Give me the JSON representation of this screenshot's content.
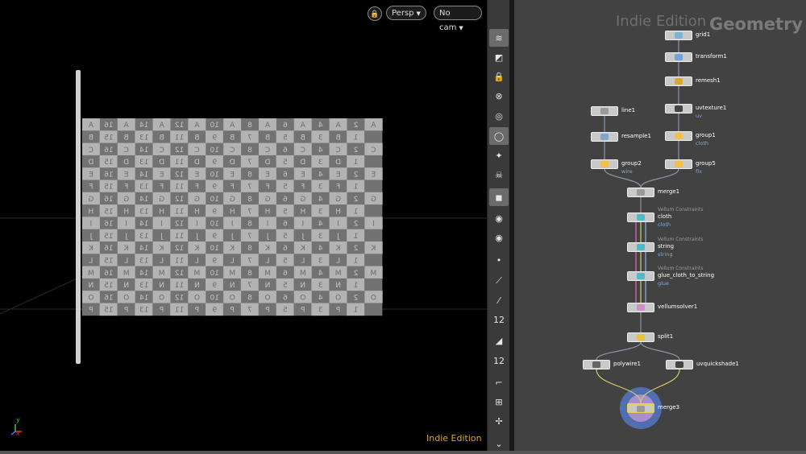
{
  "viewport": {
    "lock_icon": "lock-icon",
    "persp_label": "Persp",
    "camera_label": "No cam",
    "indie_label": "Indie Edition",
    "axis": {
      "x": "x",
      "y": "y"
    },
    "cloth_rows": [
      [
        "A",
        "16",
        "A",
        "14",
        "A",
        "12",
        "A",
        "10",
        "A",
        "8",
        "A",
        "6",
        "A",
        "4",
        "A",
        "2",
        "A"
      ],
      [
        "B",
        "15",
        "B",
        "13",
        "B",
        "11",
        "B",
        "9",
        "B",
        "7",
        "B",
        "5",
        "B",
        "3",
        "B",
        "1"
      ],
      [
        "C",
        "16",
        "C",
        "14",
        "C",
        "12",
        "C",
        "10",
        "C",
        "8",
        "C",
        "6",
        "C",
        "4",
        "C",
        "2",
        "C"
      ],
      [
        "D",
        "15",
        "D",
        "13",
        "D",
        "11",
        "D",
        "9",
        "D",
        "7",
        "D",
        "5",
        "D",
        "3",
        "D",
        "1"
      ],
      [
        "E",
        "16",
        "E",
        "14",
        "E",
        "12",
        "E",
        "10",
        "E",
        "8",
        "E",
        "6",
        "E",
        "4",
        "E",
        "2",
        "E"
      ],
      [
        "F",
        "15",
        "F",
        "13",
        "F",
        "11",
        "F",
        "9",
        "F",
        "7",
        "F",
        "5",
        "F",
        "3",
        "F",
        "1"
      ],
      [
        "G",
        "16",
        "G",
        "14",
        "G",
        "12",
        "G",
        "10",
        "G",
        "8",
        "G",
        "6",
        "G",
        "4",
        "G",
        "2",
        "G"
      ],
      [
        "H",
        "15",
        "H",
        "13",
        "H",
        "11",
        "H",
        "9",
        "H",
        "7",
        "H",
        "5",
        "H",
        "3",
        "H",
        "1"
      ],
      [
        "I",
        "16",
        "I",
        "14",
        "I",
        "12",
        "I",
        "10",
        "I",
        "8",
        "I",
        "6",
        "I",
        "4",
        "I",
        "2",
        "I"
      ],
      [
        "J",
        "15",
        "J",
        "13",
        "J",
        "11",
        "J",
        "9",
        "J",
        "7",
        "J",
        "5",
        "J",
        "3",
        "J",
        "1"
      ],
      [
        "K",
        "16",
        "K",
        "14",
        "K",
        "12",
        "K",
        "10",
        "K",
        "8",
        "K",
        "6",
        "K",
        "4",
        "K",
        "2",
        "K"
      ],
      [
        "L",
        "15",
        "L",
        "13",
        "L",
        "11",
        "L",
        "9",
        "L",
        "7",
        "L",
        "5",
        "L",
        "3",
        "L",
        "1"
      ],
      [
        "M",
        "16",
        "M",
        "14",
        "M",
        "12",
        "M",
        "10",
        "M",
        "8",
        "M",
        "6",
        "M",
        "4",
        "M",
        "2",
        "M"
      ],
      [
        "N",
        "15",
        "N",
        "13",
        "N",
        "11",
        "N",
        "9",
        "N",
        "7",
        "N",
        "5",
        "N",
        "3",
        "N",
        "1"
      ],
      [
        "O",
        "16",
        "O",
        "14",
        "O",
        "12",
        "O",
        "10",
        "O",
        "8",
        "O",
        "6",
        "O",
        "4",
        "O",
        "2",
        "O"
      ],
      [
        "P",
        "15",
        "P",
        "13",
        "P",
        "11",
        "P",
        "9",
        "P",
        "7",
        "P",
        "5",
        "P",
        "3",
        "P",
        "1"
      ]
    ]
  },
  "shelf": {
    "tools": [
      {
        "name": "display-options-icon",
        "glyph": "≋"
      },
      {
        "name": "view-icon",
        "glyph": "◩"
      },
      {
        "name": "lock-camera-icon",
        "glyph": "🔒"
      },
      {
        "name": "close-icon",
        "glyph": "⊗"
      },
      {
        "name": "shading-icon",
        "glyph": "◎"
      },
      {
        "name": "light-icon",
        "glyph": "◯"
      },
      {
        "name": "headlight-icon",
        "glyph": "✦"
      },
      {
        "name": "skull-icon",
        "glyph": "☠"
      },
      {
        "name": "camera-icon",
        "glyph": "◼"
      },
      {
        "name": "visibility-eye-icon",
        "glyph": "◉"
      },
      {
        "name": "ghost-eye-icon",
        "glyph": "◉"
      },
      {
        "name": "point-icon",
        "glyph": "•"
      },
      {
        "name": "normal-icon",
        "glyph": "⟋"
      },
      {
        "name": "point-normal-icon",
        "glyph": "⁄"
      },
      {
        "name": "point-number-icon",
        "glyph": "12"
      },
      {
        "name": "primitive-icon",
        "glyph": "◢"
      },
      {
        "name": "primitive-number-icon",
        "glyph": "12"
      },
      {
        "name": "edge-icon",
        "glyph": "⌐"
      },
      {
        "name": "grid-select-icon",
        "glyph": "⊞"
      },
      {
        "name": "snap-icon",
        "glyph": "✢"
      },
      {
        "name": "scroll-down-icon",
        "glyph": "⌄"
      }
    ]
  },
  "network": {
    "indie_label": "Indie Edition",
    "context_label": "Geometry",
    "nodes": [
      {
        "id": "grid1",
        "label": "grid1",
        "sub": "",
        "badge": "",
        "color": "#7fb3d6"
      },
      {
        "id": "transform1",
        "label": "transform1",
        "sub": "",
        "badge": "",
        "color": "#6fa6d9"
      },
      {
        "id": "remesh1",
        "label": "remesh1",
        "sub": "",
        "badge": "",
        "color": "#d9a63a"
      },
      {
        "id": "uvtexture1",
        "label": "uvtexture1",
        "sub": "uv",
        "badge": "",
        "color": "#444444"
      },
      {
        "id": "line1",
        "label": "line1",
        "sub": "",
        "badge": "",
        "color": "#9a9a9a"
      },
      {
        "id": "group1",
        "label": "group1",
        "sub": "cloth",
        "badge": "",
        "color": "#f2c04a"
      },
      {
        "id": "resample1",
        "label": "resample1",
        "sub": "",
        "badge": "",
        "color": "#7fa6cf"
      },
      {
        "id": "group2",
        "label": "group2",
        "sub": "wire",
        "badge": "",
        "color": "#f2c04a"
      },
      {
        "id": "group5",
        "label": "group5",
        "sub": "fix",
        "badge": "",
        "color": "#f2c04a"
      },
      {
        "id": "merge1",
        "label": "merge1",
        "sub": "",
        "badge": "",
        "color": "#9a9a9a"
      },
      {
        "id": "cloth",
        "label": "cloth",
        "sub": "cloth",
        "badge": "Vellum Constraints",
        "color": "#4fb9c6"
      },
      {
        "id": "string",
        "label": "string",
        "sub": "string",
        "badge": "Vellum Constraints",
        "color": "#4fb9c6"
      },
      {
        "id": "glue",
        "label": "glue_cloth_to_string",
        "sub": "glue",
        "badge": "Vellum Constraints",
        "color": "#4fb9c6"
      },
      {
        "id": "vellumsolver1",
        "label": "vellumsolver1",
        "sub": "",
        "badge": "",
        "color": "#cf8fc9"
      },
      {
        "id": "split1",
        "label": "split1",
        "sub": "",
        "badge": "",
        "color": "#e9c23f"
      },
      {
        "id": "polywire1",
        "label": "polywire1",
        "sub": "",
        "badge": "",
        "color": "#666666"
      },
      {
        "id": "uvquickshade1",
        "label": "uvquickshade1",
        "sub": "",
        "badge": "",
        "color": "#444444"
      },
      {
        "id": "merge3",
        "label": "merge3",
        "sub": "",
        "badge": "",
        "color": "#9a9a9a"
      }
    ]
  }
}
